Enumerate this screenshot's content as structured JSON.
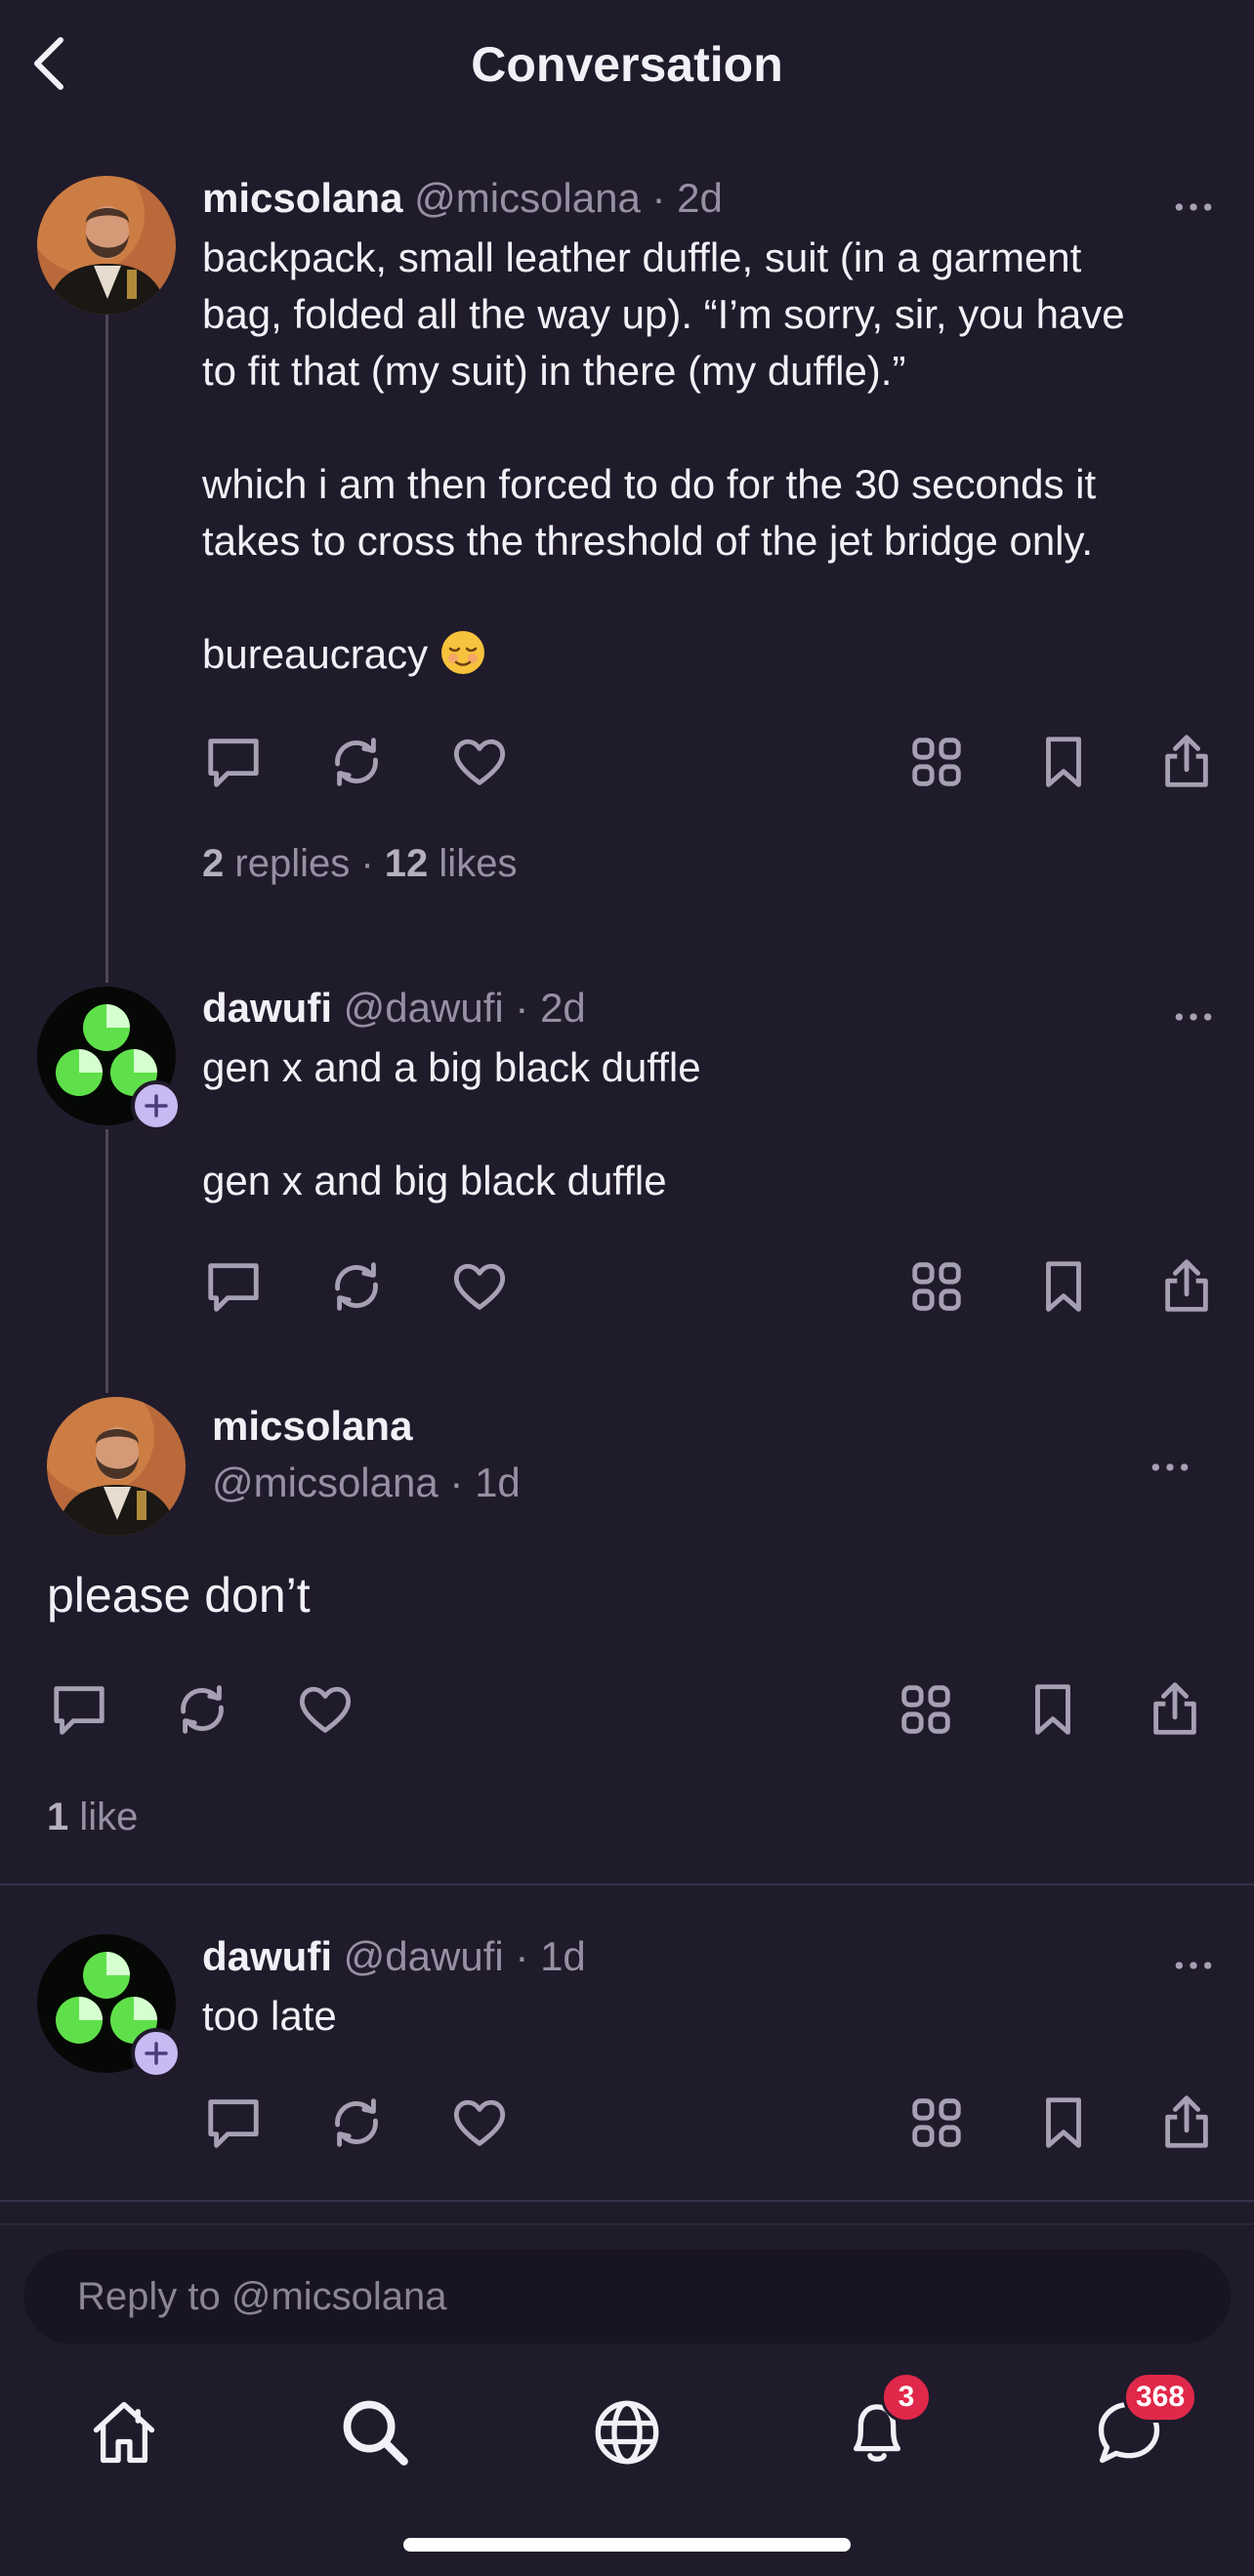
{
  "header": {
    "title": "Conversation"
  },
  "posts": [
    {
      "name": "micsolana",
      "handle": "@micsolana",
      "separator": "·",
      "time": "2d",
      "lines": [
        "backpack, small leather duffle, suit (in a garment",
        "bag, folded all the way up). “I’m sorry, sir, you have",
        "to fit that (my suit) in there (my duffle).”",
        "which i am then forced to do for the 30 seconds it",
        "takes to cross the threshold of the jet bridge only.",
        "bureaucracy"
      ],
      "replies_count": "2",
      "replies_label": "replies",
      "stats_separator": "·",
      "likes_count": "12",
      "likes_label": "likes"
    },
    {
      "name": "dawufi",
      "handle": "@dawufi",
      "separator": "·",
      "time": "2d",
      "lines": [
        "gen x and a big black duffle",
        "gen x and big black duffle"
      ]
    },
    {
      "name": "micsolana",
      "handle": "@micsolana",
      "separator": "·",
      "time": "1d",
      "text": "please don’t",
      "likes_count": "1",
      "likes_label": "like"
    },
    {
      "name": "dawufi",
      "handle": "@dawufi",
      "separator": "·",
      "time": "1d",
      "text": "too late"
    }
  ],
  "reply": {
    "placeholder": "Reply to @micsolana"
  },
  "tabbar": {
    "notifications_badge": "3",
    "messages_badge": "368"
  },
  "colors": {
    "background": "#201b2b",
    "accent": "#c9b9f2",
    "badge": "#e0284a",
    "muted": "#9690a3"
  },
  "icons": [
    "back-icon",
    "more-icon",
    "reply-icon",
    "repost-icon",
    "like-icon",
    "grid-icon",
    "bookmark-icon",
    "share-icon",
    "home-icon",
    "search-icon",
    "globe-icon",
    "bell-icon",
    "chat-icon"
  ]
}
